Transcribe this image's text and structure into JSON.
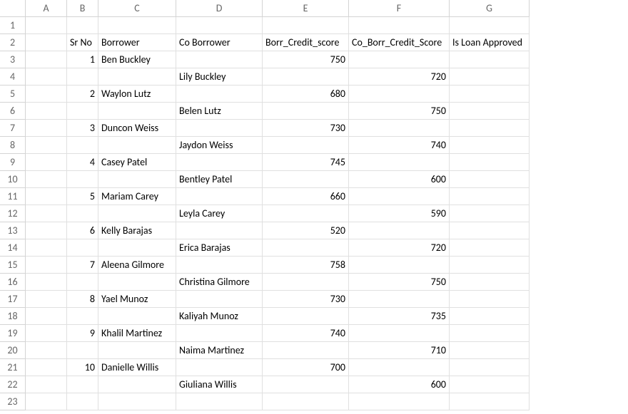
{
  "columns": [
    "A",
    "B",
    "C",
    "D",
    "E",
    "F",
    "G"
  ],
  "row_count": 23,
  "headers": {
    "B": "Sr No",
    "C": "Borrower",
    "D": "Co Borrower",
    "E": "Borr_Credit_score",
    "F": "Co_Borr_Credit_Score",
    "G": "Is Loan Approved"
  },
  "rows": [
    {
      "sr": 1,
      "borrower": "Ben Buckley",
      "co_borrower": "Lily Buckley",
      "borr_score": 750,
      "co_score": 720
    },
    {
      "sr": 2,
      "borrower": "Waylon Lutz",
      "co_borrower": "Belen Lutz",
      "borr_score": 680,
      "co_score": 750
    },
    {
      "sr": 3,
      "borrower": "Duncon Weiss",
      "co_borrower": "Jaydon Weiss",
      "borr_score": 730,
      "co_score": 740
    },
    {
      "sr": 4,
      "borrower": "Casey Patel",
      "co_borrower": "Bentley Patel",
      "borr_score": 745,
      "co_score": 600
    },
    {
      "sr": 5,
      "borrower": "Mariam Carey",
      "co_borrower": "Leyla Carey",
      "borr_score": 660,
      "co_score": 590
    },
    {
      "sr": 6,
      "borrower": "Kelly Barajas",
      "co_borrower": "Erica Barajas",
      "borr_score": 520,
      "co_score": 720
    },
    {
      "sr": 7,
      "borrower": "Aleena Gilmore",
      "co_borrower": "Christina Gilmore",
      "borr_score": 758,
      "co_score": 750
    },
    {
      "sr": 8,
      "borrower": "Yael Munoz",
      "co_borrower": "Kaliyah Munoz",
      "borr_score": 730,
      "co_score": 735
    },
    {
      "sr": 9,
      "borrower": "Khalil Martinez",
      "co_borrower": "Naima Martinez",
      "borr_score": 740,
      "co_score": 710
    },
    {
      "sr": 10,
      "borrower": "Danielle Willis",
      "co_borrower": "Giuliana Willis",
      "borr_score": 700,
      "co_score": 600
    }
  ]
}
